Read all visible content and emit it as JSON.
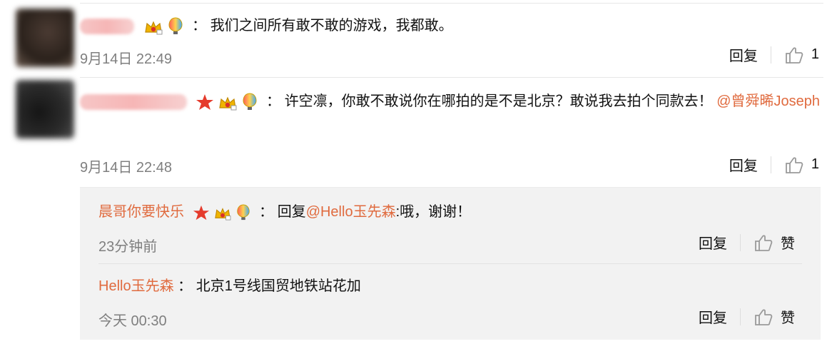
{
  "comments": [
    {
      "text": "我们之间所有敢不敢的游戏，我都敢。",
      "time": "9月14日 22:49",
      "reply_label": "回复",
      "like_count": "1"
    },
    {
      "text": "许空凛，你敢不敢说你在哪拍的是不是北京？敢说我去拍个同款去！",
      "mention": "@曾舜晞Joseph",
      "time": "9月14日 22:48",
      "reply_label": "回复",
      "like_count": "1"
    }
  ],
  "replies": [
    {
      "name": "晨哥你要快乐",
      "prefix": "回复",
      "mention": "@Hello玉先森",
      "text": ":哦，谢谢！",
      "time": "23分钟前",
      "reply_label": "回复",
      "like_label": "赞"
    },
    {
      "name": "Hello玉先森",
      "text": "北京1号线国贸地铁站花加",
      "time": "今天 00:30",
      "reply_label": "回复",
      "like_label": "赞"
    }
  ],
  "colors": {
    "link": "#e06b3f",
    "muted": "#7f7f7f",
    "divider": "#e7e7e7"
  },
  "icons": [
    "crown-icon",
    "balloon-icon",
    "star-icon",
    "thumb-up-icon"
  ]
}
